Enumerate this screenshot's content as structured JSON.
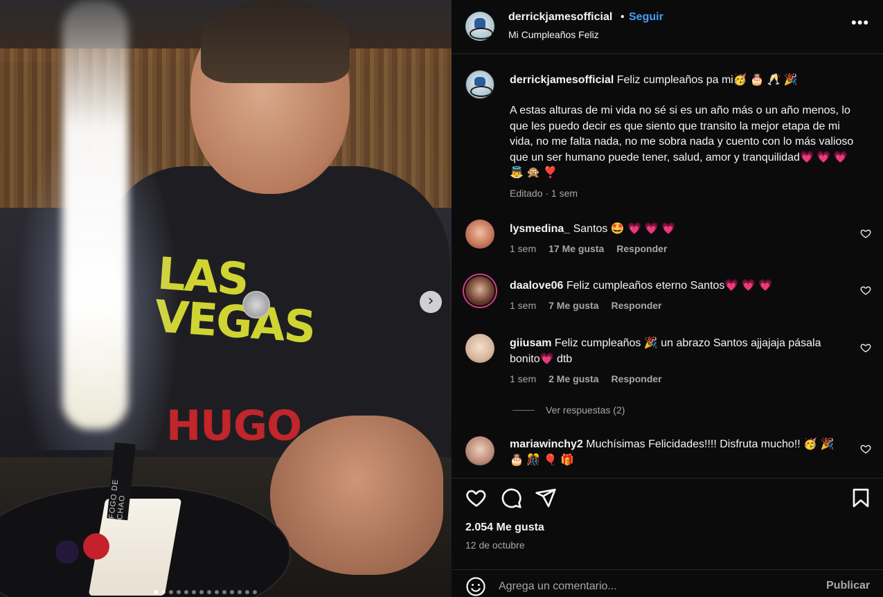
{
  "photo": {
    "shirt_text_line1": "LAS VEGAS",
    "shirt_text_line2": "HUGO",
    "stick_label": "FOGO DE CHAO",
    "carousel_total": 14,
    "carousel_active": 1
  },
  "header": {
    "username": "derrickjamesofficial",
    "separator": "•",
    "follow_label": "Seguir",
    "subtitle": "Mi Cumpleaños Feliz",
    "more_icon": "more-horizontal-icon"
  },
  "caption": {
    "username": "derrickjamesofficial",
    "title": "Feliz cumpleaños pa mi🥳 🎂 🥂 🎉",
    "body": "A estas alturas de mi vida no sé si es un año más o un año menos, lo que les puedo decir es que siento que transito la mejor etapa de mi vida, no me falta nada, no me sobra nada y cuento con lo más valioso que un ser humano puede tener, salud, amor y tranquilidad💗 💗 💗 👼 🙊 ❣️",
    "meta": "Editado · 1 sem"
  },
  "comments": [
    {
      "username": "lysmedina_",
      "text": "Santos 🤩  💗 💗 💗",
      "time": "1 sem",
      "likes": "17 Me gusta",
      "reply": "Responder"
    },
    {
      "username": "daalove06",
      "text": "Feliz cumpleaños eterno Santos💗 💗 💗",
      "time": "1 sem",
      "likes": "7 Me gusta",
      "reply": "Responder"
    },
    {
      "username": "giiusam",
      "text": "Feliz cumpleaños 🎉  un abrazo Santos ajjajaja pásala bonito💗  dtb",
      "time": "1 sem",
      "likes": "2 Me gusta",
      "reply": "Responder"
    },
    {
      "username": "mariawinchy2",
      "text": "Muchísimas Felicidades!!!! Disfruta mucho!! 🥳 🎉 🎂 🎊 🎈 🎁"
    }
  ],
  "view_replies": "Ver respuestas (2)",
  "actions": {
    "like_icon": "heart-icon",
    "comment_icon": "comment-icon",
    "share_icon": "share-icon",
    "save_icon": "bookmark-icon"
  },
  "likes_count": "2.054 Me gusta",
  "post_date": "12 de octubre",
  "add_comment": {
    "placeholder": "Agrega un comentario...",
    "publish_label": "Publicar"
  },
  "colors": {
    "follow": "#4a9df8",
    "background": "#0b0b0b",
    "muted_text": "#a8a8a8"
  }
}
